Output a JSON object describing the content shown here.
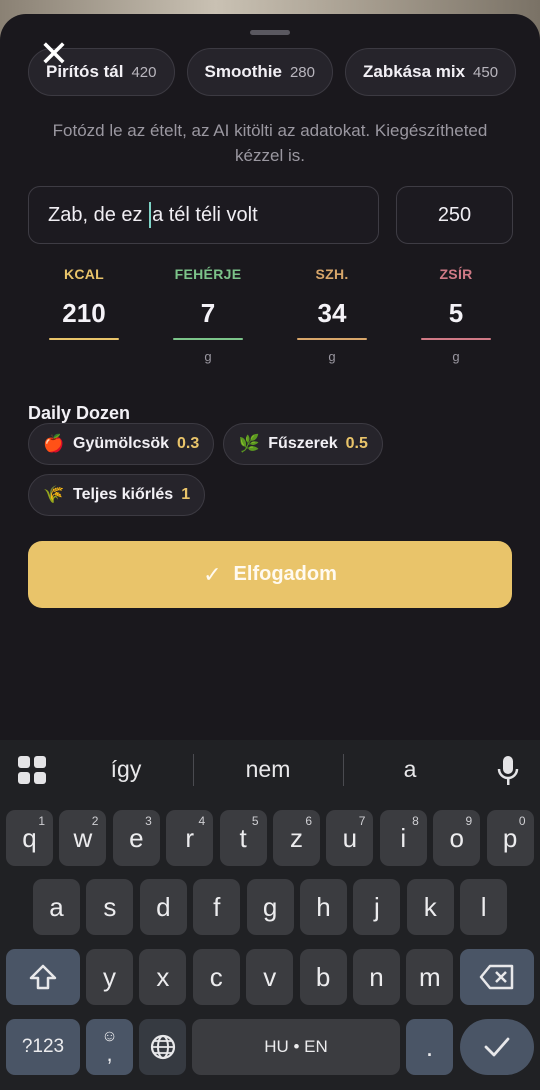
{
  "presets": [
    {
      "name": "Pirítós tál",
      "kcal": "420"
    },
    {
      "name": "Smoothie",
      "kcal": "280"
    },
    {
      "name": "Zabkása mix",
      "kcal": "450"
    }
  ],
  "hint": "Fotózd le az ételt, az AI kitölti az adatokat. Kiegészítheted kézzel is.",
  "food_input": {
    "before_cursor": "Zab, de ez ",
    "after_cursor": "a tél téli volt"
  },
  "grams_value": "250",
  "macros": [
    {
      "label": "KCAL",
      "value": "210",
      "unit": "",
      "color": "#e9c46a"
    },
    {
      "label": "FEHÉRJE",
      "value": "7",
      "unit": "g",
      "color": "#7cc48a"
    },
    {
      "label": "SZH.",
      "value": "34",
      "unit": "g",
      "color": "#d8a66a"
    },
    {
      "label": "ZSÍR",
      "value": "5",
      "unit": "g",
      "color": "#d07a86"
    }
  ],
  "daily_dozen": {
    "title": "Daily Dozen",
    "chips": [
      {
        "icon": "apple-icon",
        "emoji": "🍎",
        "name": "Gyümölcsök",
        "value": "0.3"
      },
      {
        "icon": "herb-icon",
        "emoji": "🌿",
        "name": "Fűszerek",
        "value": "0.5"
      },
      {
        "icon": "wheat-icon",
        "emoji": "🌾",
        "name": "Teljes kiőrlés",
        "value": "1"
      }
    ]
  },
  "accept_label": "Elfogadom",
  "colors": {
    "accent": "#e9c46a",
    "background": "#1a181d"
  },
  "keyboard": {
    "suggestions": [
      "így",
      "nem",
      "a"
    ],
    "row1": [
      {
        "k": "q",
        "s": "1"
      },
      {
        "k": "w",
        "s": "2"
      },
      {
        "k": "e",
        "s": "3"
      },
      {
        "k": "r",
        "s": "4"
      },
      {
        "k": "t",
        "s": "5"
      },
      {
        "k": "z",
        "s": "6"
      },
      {
        "k": "u",
        "s": "7"
      },
      {
        "k": "i",
        "s": "8"
      },
      {
        "k": "o",
        "s": "9"
      },
      {
        "k": "p",
        "s": "0"
      }
    ],
    "row2": [
      "a",
      "s",
      "d",
      "f",
      "g",
      "h",
      "j",
      "k",
      "l"
    ],
    "row3": [
      "y",
      "x",
      "c",
      "v",
      "b",
      "n",
      "m"
    ],
    "symbols_label": "?123",
    "emoji_comma": ",",
    "space_label": "HU • EN",
    "period_label": "."
  }
}
